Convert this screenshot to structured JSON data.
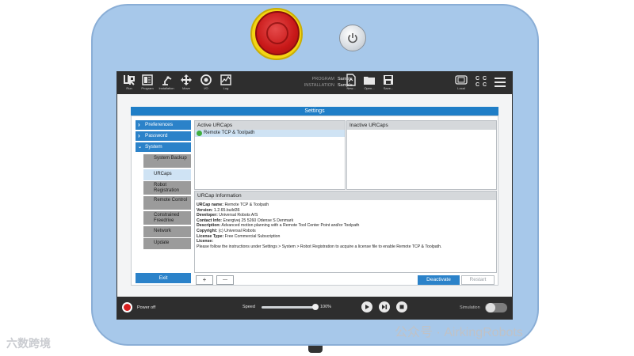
{
  "topbar": {
    "tabs": [
      {
        "label": "Run",
        "icon": "ur-logo-icon"
      },
      {
        "label": "Program",
        "icon": "program-icon"
      },
      {
        "label": "Installation",
        "icon": "robot-arm-icon"
      },
      {
        "label": "Move",
        "icon": "move-arrows-icon"
      },
      {
        "label": "I/O",
        "icon": "io-icon"
      },
      {
        "label": "Log",
        "icon": "log-chart-icon"
      }
    ],
    "program_label": "PROGRAM",
    "program_value": "Sample",
    "installation_label": "INSTALLATION",
    "installation_value": "Sample",
    "file_buttons": [
      {
        "label": "New...",
        "icon": "new-file-icon"
      },
      {
        "label": "Open...",
        "icon": "folder-icon"
      },
      {
        "label": "Save...",
        "icon": "save-icon"
      }
    ],
    "local_label": "Local",
    "cc_labels": [
      "C C",
      "C C"
    ]
  },
  "settings": {
    "title": "Settings",
    "nav": [
      {
        "label": "Preferences",
        "expanded": false
      },
      {
        "label": "Password",
        "expanded": false
      },
      {
        "label": "System",
        "expanded": true
      }
    ],
    "sub_items": [
      {
        "label": "System Backup",
        "active": false
      },
      {
        "label": "URCaps",
        "active": true
      },
      {
        "label": "Robot Registration",
        "active": false
      },
      {
        "label": "Remote Control",
        "active": false
      },
      {
        "label": "Constrained Freedrive",
        "active": false
      },
      {
        "label": "Network",
        "active": false
      },
      {
        "label": "Update",
        "active": false
      }
    ],
    "exit_label": "Exit",
    "active_urcaps_title": "Active URCaps",
    "inactive_urcaps_title": "Inactive URCaps",
    "active_urcaps": [
      "Remote TCP & Toolpath"
    ],
    "info_title": "URCap Information",
    "info": {
      "name_label": "URCap name:",
      "name_value": "Remote TCP & Toolpath",
      "version_label": "Version:",
      "version_value": "1.2.65.build36",
      "developer_label": "Developer:",
      "developer_value": "Universal Robots A/S",
      "contact_label": "Contact Info:",
      "contact_value": "Energivej 25 5260 Odense S Denmark",
      "description_label": "Description:",
      "description_value": "Advanced motion planning with a Remote Tool Center Point and/or Toolpath",
      "copyright_label": "Copyright:",
      "copyright_value": "(c) Universal Robots",
      "license_type_label": "License Type:",
      "license_type_value": "Free Commercial Subscription",
      "license_label": "License:",
      "license_text": "Please follow the instructions under Settings > System > Robot Registration to acquire a license file to enable Remote TCP & Toolpath."
    },
    "add_label": "+",
    "remove_label": "—",
    "deactivate_label": "Deactivate",
    "restart_label": "Restart"
  },
  "bottombar": {
    "power_label": "Power off",
    "speed_label": "Speed",
    "speed_value": "100%",
    "speed_fraction": 1.0,
    "simulation_label": "Simulation"
  },
  "watermarks": {
    "left": "六数跨境",
    "right": "公众号 · AirkingRobots"
  }
}
